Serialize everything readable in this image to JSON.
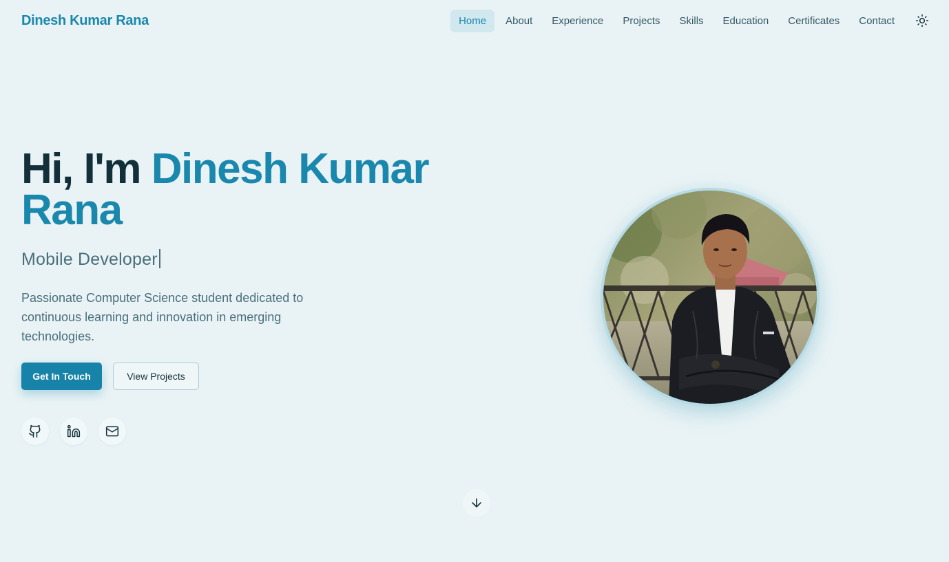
{
  "header": {
    "brand": "Dinesh Kumar Rana",
    "nav": [
      "Home",
      "About",
      "Experience",
      "Projects",
      "Skills",
      "Education",
      "Certificates",
      "Contact"
    ],
    "active_nav": "Home",
    "theme_icon": "sun-icon"
  },
  "hero": {
    "greeting": "Hi, I'm ",
    "name_line1": "Dinesh Kumar",
    "name_line2": "Rana",
    "role": "Mobile Developer",
    "description": "Passionate Computer Science student dedicated to continuous learning and innovation in emerging technologies.",
    "primary_button": "Get In Touch",
    "secondary_button": "View Projects",
    "social_icons": [
      "github-icon",
      "linkedin-icon",
      "mail-icon"
    ],
    "scroll_icon": "arrow-down-icon"
  },
  "colors": {
    "background": "#e9f3f5",
    "accent": "#1a87ad",
    "heading": "#13303a",
    "muted": "#4a6e7c"
  }
}
